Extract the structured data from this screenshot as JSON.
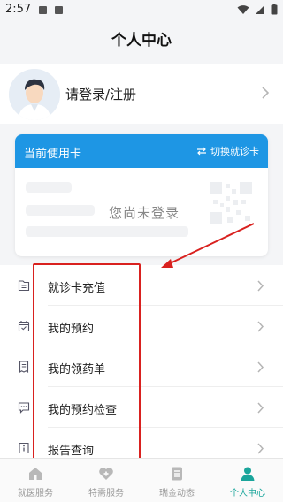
{
  "status_bar": {
    "time": "2:57"
  },
  "header": {
    "title": "个人中心"
  },
  "login": {
    "label": "请登录/注册"
  },
  "card": {
    "title": "当前使用卡",
    "switch_label": "切换就诊卡",
    "empty_message": "您尚未登录"
  },
  "menu": {
    "items": [
      {
        "label": "就诊卡充值",
        "icon": "card-icon"
      },
      {
        "label": "我的预约",
        "icon": "calendar-icon"
      },
      {
        "label": "我的领药单",
        "icon": "receipt-icon"
      },
      {
        "label": "我的预约检查",
        "icon": "chat-icon"
      },
      {
        "label": "报告查询",
        "icon": "info-icon"
      }
    ]
  },
  "bottom_nav": {
    "tabs": [
      {
        "label": "就医服务",
        "icon": "home-icon",
        "active": false
      },
      {
        "label": "特需服务",
        "icon": "heart-icon",
        "active": false
      },
      {
        "label": "瑞金动态",
        "icon": "news-icon",
        "active": false
      },
      {
        "label": "个人中心",
        "icon": "person-icon",
        "active": true
      }
    ]
  },
  "colors": {
    "accent_blue": "#1e96e4",
    "accent_teal": "#1aa59b",
    "annotation_red": "#d9211f"
  }
}
